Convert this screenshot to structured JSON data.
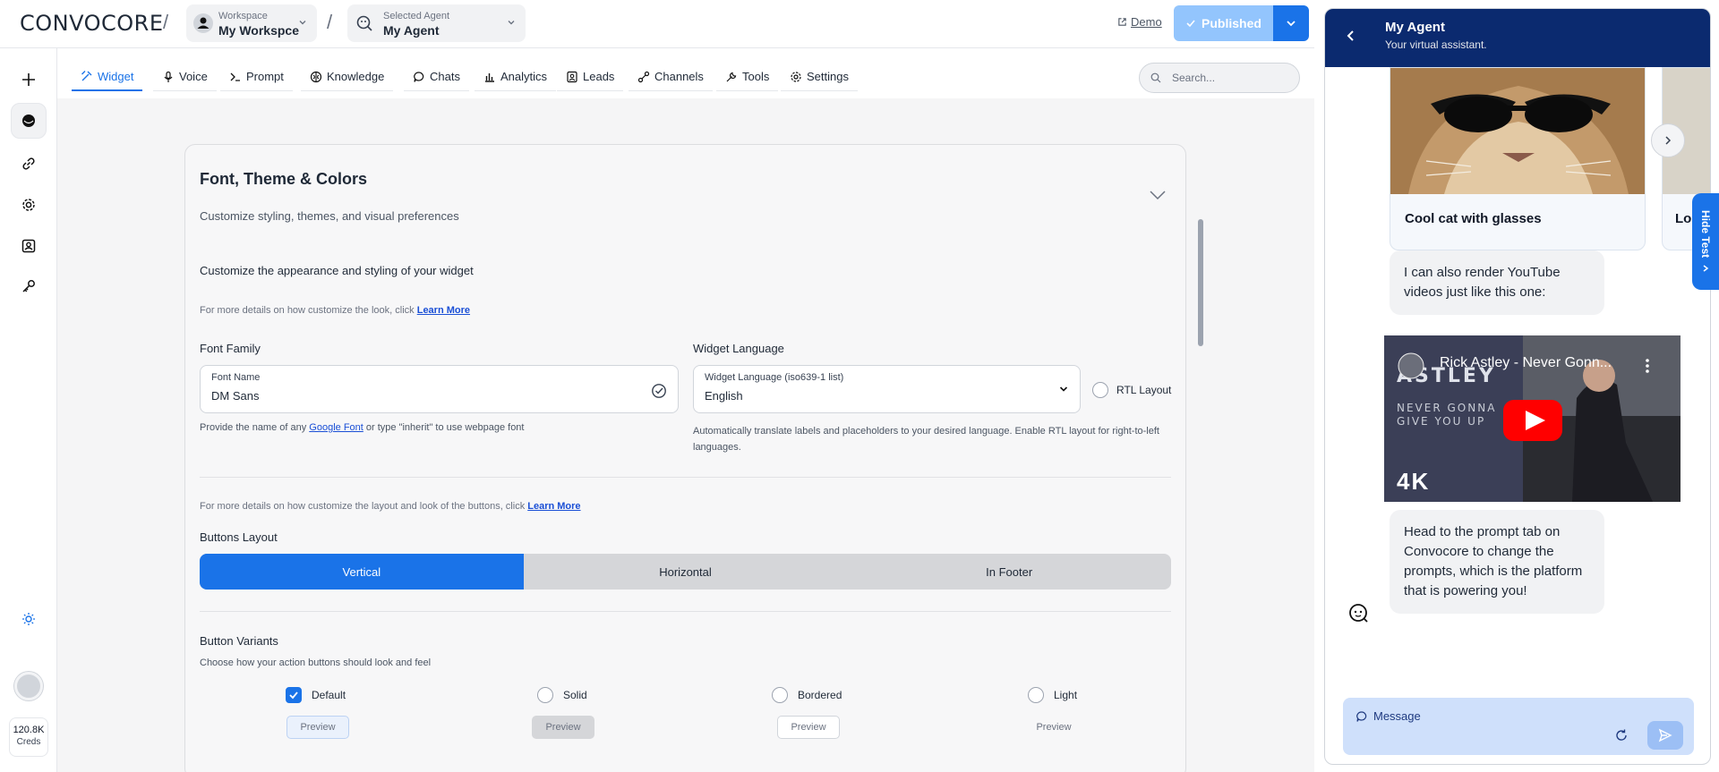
{
  "brand": {
    "logo_text": "CONVOCORE"
  },
  "workspace": {
    "label": "Workspace",
    "value": "My Workspce"
  },
  "agent_selector": {
    "label": "Selected Agent",
    "value": "My Agent"
  },
  "header": {
    "demo_label": "Demo",
    "publish_label": "Published"
  },
  "tabs": [
    {
      "label": "Widget",
      "icon": "widget-icon"
    },
    {
      "label": "Voice",
      "icon": "microphone-icon"
    },
    {
      "label": "Prompt",
      "icon": "terminal-icon"
    },
    {
      "label": "Knowledge",
      "icon": "brain-icon"
    },
    {
      "label": "Chats",
      "icon": "chat-icon"
    },
    {
      "label": "Analytics",
      "icon": "bar-chart-icon"
    },
    {
      "label": "Leads",
      "icon": "contact-icon"
    },
    {
      "label": "Channels",
      "icon": "channels-icon"
    },
    {
      "label": "Tools",
      "icon": "wrench-icon"
    },
    {
      "label": "Settings",
      "icon": "gear-icon"
    }
  ],
  "search": {
    "placeholder": "Search..."
  },
  "rail": {
    "creds_value": "120.8K",
    "creds_label": "Creds"
  },
  "section": {
    "title": "Font, Theme & Colors",
    "subtitle": "Customize styling, themes, and visual preferences",
    "appearance_title": "Customize the appearance and styling of your widget",
    "hint1_text": "For more details on how customize the look, click ",
    "hint1_link": "Learn More",
    "font_family_label": "Font Family",
    "font_name_label": "Font Name",
    "font_name_value": "DM Sans",
    "font_help_before": "Provide the name of any ",
    "font_help_link": "Google Font",
    "font_help_after": " or type \"inherit\" to use webpage font",
    "language_label": "Widget Language",
    "language_field_label": "Widget Language (iso639-1 list)",
    "language_value": "English",
    "rtl_label": "RTL Layout",
    "language_help": "Automatically translate labels and placeholders to your desired language. Enable RTL layout for right-to-left languages.",
    "hint2_text": "For more details on how customize the layout and look of the buttons, click ",
    "hint2_link": "Learn More",
    "buttons_layout_label": "Buttons Layout",
    "layout_options": [
      "Vertical",
      "Horizontal",
      "In Footer"
    ],
    "button_variants_label": "Button Variants",
    "button_variants_sub": "Choose how your action buttons should look and feel",
    "variants": [
      "Default",
      "Solid",
      "Bordered",
      "Light"
    ],
    "preview_label": "Preview"
  },
  "chat": {
    "title": "My Agent",
    "subtitle": "Your virtual assistant.",
    "card_title": "Cool cat with glasses",
    "card2_title": "Lo",
    "bubble1": "I can also render YouTube videos just like this one:",
    "video_title": "Rick Astley - Never Gonn...",
    "video_badge": "4K",
    "bubble2": "Head to the prompt tab on Convocore to change the prompts, which is the platform that is powering you!",
    "message_placeholder": "Message",
    "hide_label": "Hide Test"
  },
  "colors": {
    "accent": "#1a73e8",
    "chat_header": "#0b2a6f",
    "publish_light": "#93c5fd"
  }
}
